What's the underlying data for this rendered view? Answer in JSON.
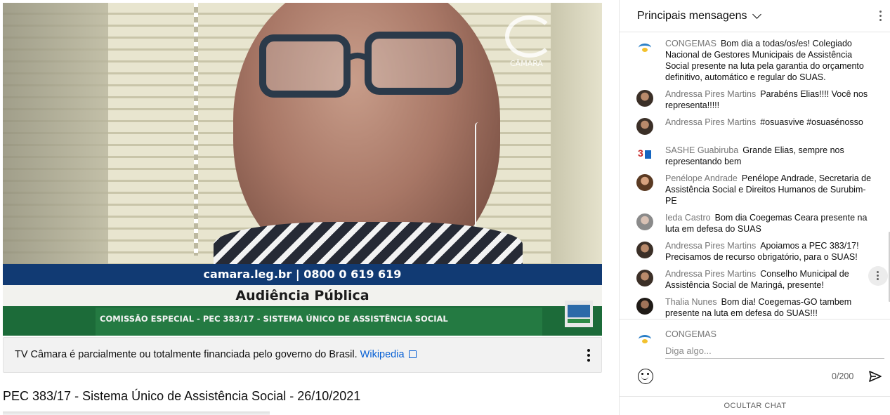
{
  "video": {
    "logo_text": "CÂMARA",
    "banner_contact": "camara.leg.br | 0800 0 619 619",
    "banner_title": "Audiência Pública",
    "banner_subtitle": "COMISSÃO ESPECIAL - PEC 383/17 - SISTEMA ÚNICO DE ASSISTÊNCIA SOCIAL"
  },
  "info_panel": {
    "text": "TV Câmara é parcialmente ou totalmente financiada pelo governo do Brasil.",
    "link": "Wikipedia"
  },
  "video_title": "PEC 383/17 - Sistema Único de Assistência Social - 26/10/2021",
  "chat": {
    "header_title": "Principais mensagens",
    "messages": [
      {
        "author": "CONGEMAS",
        "text": "Bom dia a todas/os/es! Colegiado Nacional de Gestores Municipais de Assistência Social presente na luta pela garantia do orçamento definitivo, automático e regular do SUAS.",
        "avatar": "congemas-logo"
      },
      {
        "author": "Andressa Pires Martins",
        "text": "Parabéns Elias!!!! Você nos representa!!!!!",
        "avatar": "user-photo"
      },
      {
        "author": "Andressa Pires Martins",
        "text": "#osuasvive #osuasénosso",
        "avatar": "user-photo"
      },
      {
        "author": "SASHE Guabiruba",
        "text": "Grande Elias, sempre nos representando bem",
        "avatar": "sashe-logo"
      },
      {
        "author": "Penélope Andrade",
        "text": "Penélope Andrade, Secretaria de Assistência Social e Direitos Humanos de Surubim-PE",
        "avatar": "user-photo"
      },
      {
        "author": "Ieda Castro",
        "text": "Bom dia Coegemas Ceara presente na luta em defesa do SUAS",
        "avatar": "user-photo"
      },
      {
        "author": "Andressa Pires Martins",
        "text": "Apoiamos a PEC 383/17! Precisamos de recurso obrigatório, para o SUAS!",
        "avatar": "user-photo"
      },
      {
        "author": "Andressa Pires Martins",
        "text": "Conselho Municipal de Assistência Social de Maringá, presente!",
        "avatar": "user-photo"
      },
      {
        "author": "Thalia Nunes",
        "text": "Bom dia! Coegemas-GO tambem presente na luta em defesa do SUAS!!!",
        "avatar": "user-photo"
      }
    ],
    "composer": {
      "author": "CONGEMAS",
      "placeholder": "Diga algo...",
      "counter": "0/200"
    },
    "footer_button": "OCULTAR CHAT"
  },
  "colors": {
    "link": "#065fd4",
    "banner_blue": "#113a73",
    "banner_green": "#1c6b39"
  }
}
